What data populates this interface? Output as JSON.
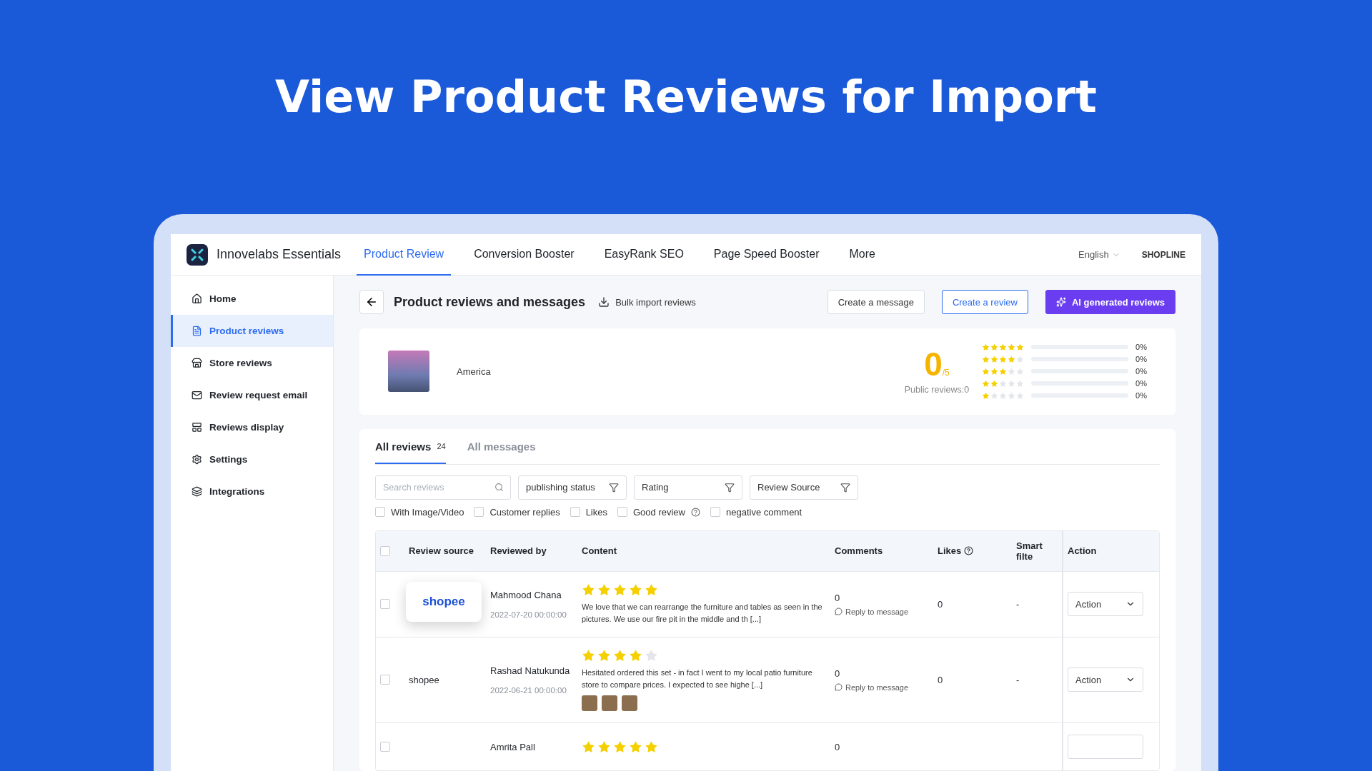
{
  "banner": {
    "title": "View Product Reviews for Import"
  },
  "app": {
    "name": "Innovelabs Essentials",
    "nav": [
      {
        "label": "Product Review",
        "selected": true
      },
      {
        "label": "Conversion Booster",
        "selected": false
      },
      {
        "label": "EasyRank SEO",
        "selected": false
      },
      {
        "label": "Page Speed Booster",
        "selected": false
      },
      {
        "label": "More",
        "selected": false
      }
    ],
    "language": "English",
    "platform": "SHOPLINE"
  },
  "sidebar": {
    "items": [
      {
        "label": "Home",
        "selected": false
      },
      {
        "label": "Product reviews",
        "selected": true
      },
      {
        "label": "Store reviews",
        "selected": false
      },
      {
        "label": "Review request email",
        "selected": false
      },
      {
        "label": "Reviews display",
        "selected": false
      },
      {
        "label": "Settings",
        "selected": false
      },
      {
        "label": "Integrations",
        "selected": false
      }
    ]
  },
  "page": {
    "title": "Product reviews and messages",
    "bulk_import": "Bulk import reviews",
    "buttons": [
      {
        "label": "Create a message",
        "kind": "default"
      },
      {
        "label": "Create a review",
        "kind": "outline"
      },
      {
        "label": "AI generated reviews",
        "kind": "primary"
      }
    ]
  },
  "summary": {
    "product": "America",
    "score": "0",
    "out_of": "/5",
    "public_reviews": "Public reviews:0",
    "distribution": [
      {
        "stars": 5,
        "level": 0,
        "percent": "0%"
      },
      {
        "stars": 4,
        "level": 0,
        "percent": "0%"
      },
      {
        "stars": 3,
        "level": 0,
        "percent": "0%"
      },
      {
        "stars": 2,
        "level": 0,
        "percent": "0%"
      },
      {
        "stars": 1,
        "level": 0,
        "percent": "0%"
      }
    ]
  },
  "tabs": [
    {
      "label": "All reviews",
      "count": "24",
      "selected": true
    },
    {
      "label": "All messages",
      "selected": false
    }
  ],
  "search": {
    "placeholder": "Search reviews"
  },
  "filters": [
    "publishing status",
    "Rating",
    "Review Source"
  ],
  "options": [
    {
      "label": "With Image/Video",
      "checked": false
    },
    {
      "label": "Customer replies",
      "checked": false
    },
    {
      "label": "Likes",
      "checked": false
    },
    {
      "label": "Good review",
      "checked": false,
      "help": true
    },
    {
      "label": "negative comment",
      "checked": false
    }
  ],
  "table": {
    "select_all_checked": false,
    "columns": [
      {
        "label": "Review source"
      },
      {
        "label": "Reviewed by"
      },
      {
        "label": "Content"
      },
      {
        "label": "Comments"
      },
      {
        "label": "Likes",
        "help": true
      },
      {
        "label": "Smart filte"
      },
      {
        "label": "Action"
      }
    ],
    "rows": [
      {
        "source": "shopee",
        "source_highlighted": true,
        "reviewer": "Mahmood Chana",
        "date": "2022-07-20 00:00:00",
        "stars": 5,
        "text": "We love that we can rearrange the furniture and tables as seen in the pictures. We use our fire pit in the middle and th [...]",
        "has_photos": false,
        "comments": "0",
        "reply": "Reply to message",
        "likes": "0",
        "smart_filter": "-",
        "action": "Action",
        "checked": false
      },
      {
        "source": "shopee",
        "source_highlighted": false,
        "reviewer": "Rashad Natukunda",
        "date": "2022-06-21 00:00:00",
        "stars": 4,
        "text": "Hesitated ordered this set - in fact I went to my local patio furniture store to compare prices. I expected to see highe [...]",
        "has_photos": true,
        "comments": "0",
        "reply": "Reply to message",
        "likes": "0",
        "smart_filter": "-",
        "action": "Action",
        "checked": false
      },
      {
        "reviewer": "Amrita Pall",
        "stars": 5,
        "comments": "0",
        "checked": false
      }
    ]
  }
}
